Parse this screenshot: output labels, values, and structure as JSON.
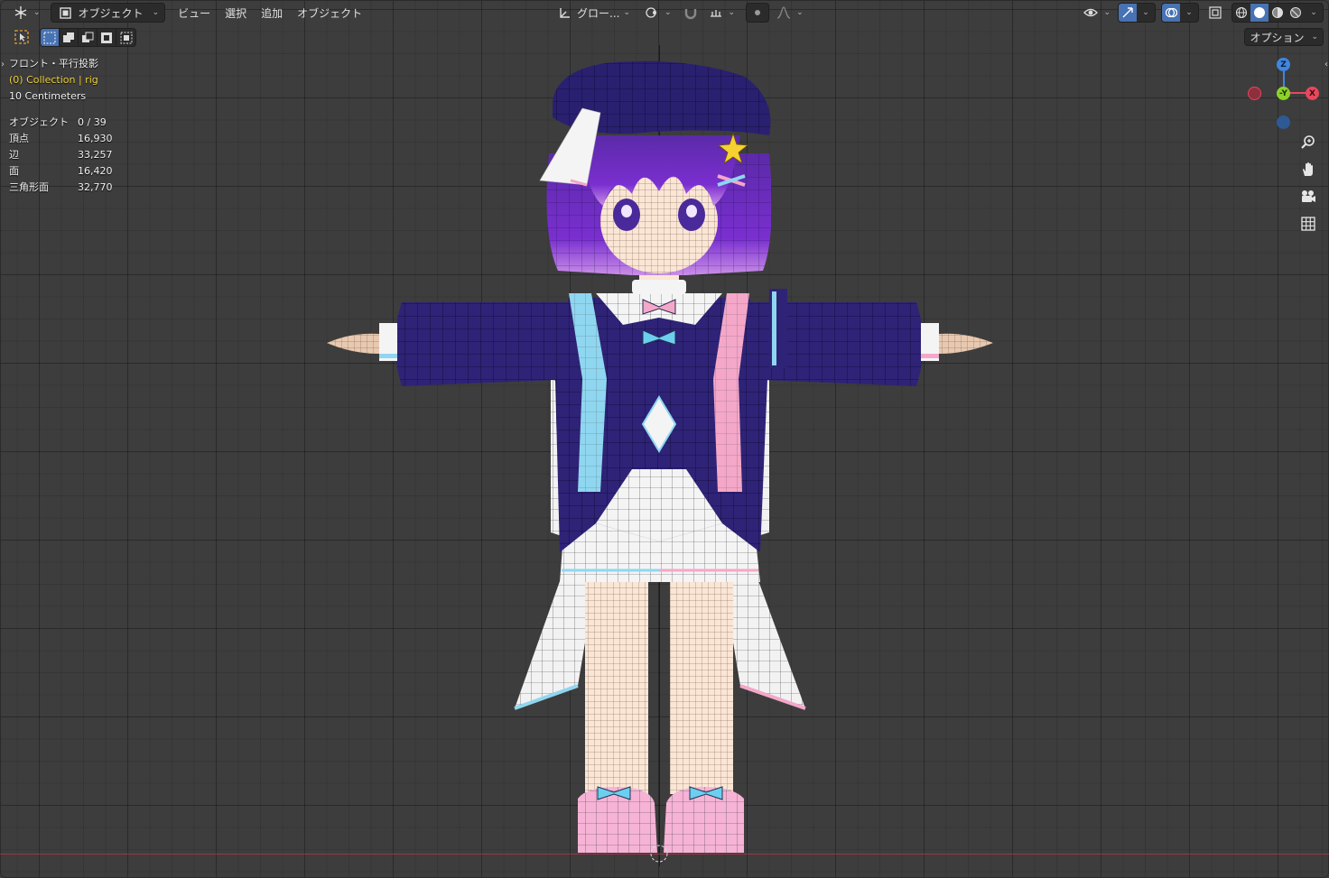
{
  "header": {
    "editor_type_icon": "3d-viewport-icon",
    "mode_label": "オブジェクト",
    "menus": [
      "ビュー",
      "選択",
      "追加",
      "オブジェクト"
    ],
    "transform_orientation": "グロー...",
    "options_label": "オプション"
  },
  "overlay": {
    "view_name": "フロント・平行投影",
    "collection": "(0) Collection | rig",
    "scale": "10 Centimeters",
    "stats": [
      {
        "label": "オブジェクト",
        "value": "0 / 39"
      },
      {
        "label": "頂点",
        "value": "16,930"
      },
      {
        "label": "辺",
        "value": "33,257"
      },
      {
        "label": "面",
        "value": "16,420"
      },
      {
        "label": "三角形面",
        "value": "32,770"
      }
    ]
  },
  "gizmo": {
    "z_label": "Z",
    "y_label": "-Y",
    "x_label": "X"
  },
  "colors": {
    "viewport_bg": "#3d3d3d",
    "accent": "#4772b3",
    "x_axis": "#e8475c",
    "y_axis": "#8bd32a",
    "z_axis": "#3f86e0",
    "collection_text": "#f0d23a"
  }
}
